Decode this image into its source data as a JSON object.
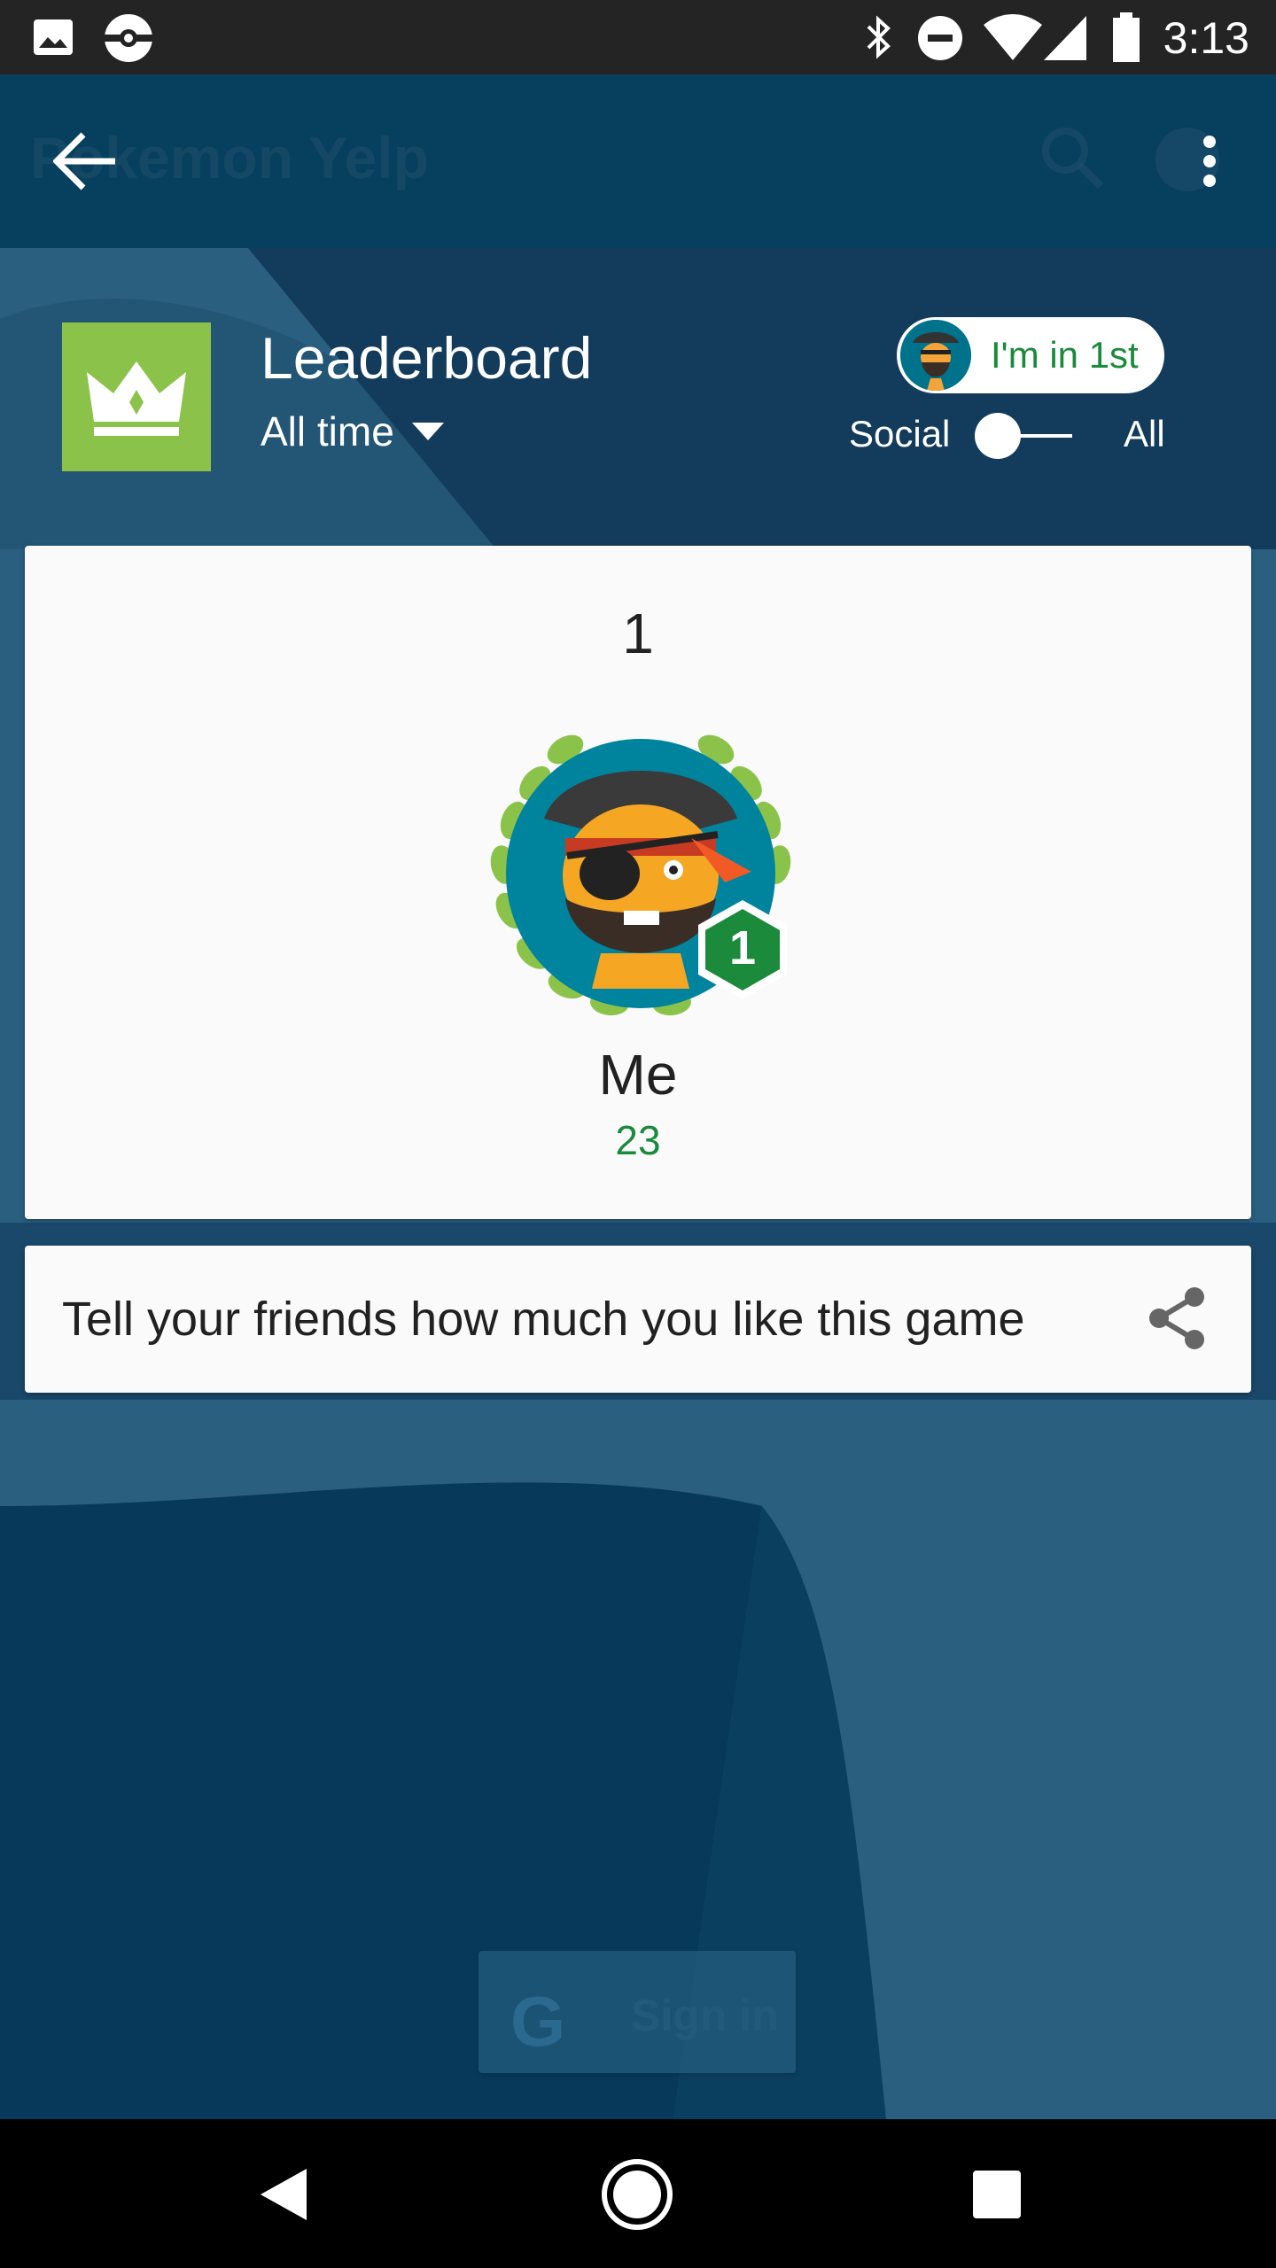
{
  "status_bar": {
    "time": "3:13",
    "icons": [
      "image-icon",
      "pokeball-icon",
      "bluetooth-icon",
      "do-not-disturb-icon",
      "wifi-icon",
      "signal-icon",
      "battery-icon"
    ]
  },
  "app_bar": {
    "title": "Pokemon Yelp",
    "icons": [
      "back-arrow-icon",
      "search-icon",
      "globe-icon",
      "more-vert-icon"
    ]
  },
  "leaderboard": {
    "title": "Leaderboard",
    "time_filter": "All time",
    "rank_pill_label": "I'm in 1st",
    "toggle_left_label": "Social",
    "toggle_right_label": "All",
    "toggle_state": "social"
  },
  "entry": {
    "rank": "1",
    "badge_number": "1",
    "name": "Me",
    "score": "23"
  },
  "share": {
    "text": "Tell your friends how much you like this game",
    "icon": "share-icon"
  },
  "signin": {
    "label": "Sign in"
  },
  "colors": {
    "badge_green": "#8bc34a",
    "score_green": "#1b8a3b",
    "app_bar": "#07405f",
    "background": "#2a5f80"
  }
}
